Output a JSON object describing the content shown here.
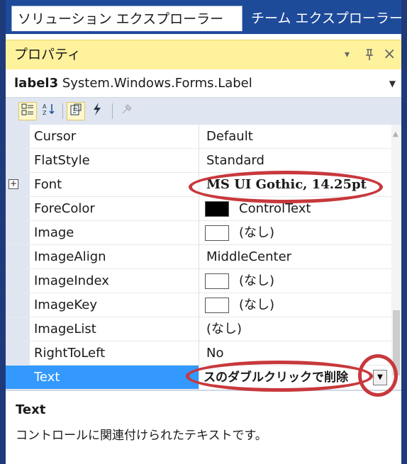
{
  "tabs": [
    {
      "label": "ソリューション エクスプローラー",
      "active": true
    },
    {
      "label": "チーム エクスプローラー",
      "active": false
    }
  ],
  "panel": {
    "title": "プロパティ",
    "icons": [
      "dropdown-arrow-icon",
      "pin-icon",
      "close-icon"
    ],
    "pin_glyph": "ᵖ",
    "close_glyph": "×",
    "dropdown_glyph": "▾"
  },
  "object_selector": {
    "name": "label3",
    "type": "System.Windows.Forms.Label"
  },
  "toolbar": {
    "buttons": [
      "categorized-icon",
      "alphabetical-icon",
      "properties-icon",
      "events-icon",
      "property-pages-icon"
    ]
  },
  "properties": [
    {
      "name": "Cursor",
      "value": "Default"
    },
    {
      "name": "FlatStyle",
      "value": "Standard"
    },
    {
      "name": "Font",
      "value": "MS UI Gothic, 14.25pt",
      "expandable": true,
      "bold": true
    },
    {
      "name": "ForeColor",
      "value": "ControlText",
      "swatch": "#000000"
    },
    {
      "name": "Image",
      "value": "(なし)",
      "swatch": "#ffffff"
    },
    {
      "name": "ImageAlign",
      "value": "MiddleCenter"
    },
    {
      "name": "ImageIndex",
      "value": "(なし)",
      "swatch": "#ffffff"
    },
    {
      "name": "ImageKey",
      "value": "(なし)",
      "swatch": "#ffffff"
    },
    {
      "name": "ImageList",
      "value": "(なし)"
    },
    {
      "name": "RightToLeft",
      "value": "No"
    },
    {
      "name": "Text",
      "value": "スのダブルクリックで削除",
      "selected": true,
      "bold": true
    }
  ],
  "description": {
    "title": "Text",
    "text": "コントロールに関連付けられたテキストです。"
  },
  "colors": {
    "title_bar": "#fff29d",
    "tab_strip": "#1e4a9a",
    "selection": "#3399ff",
    "annotation": "#c8383c"
  }
}
